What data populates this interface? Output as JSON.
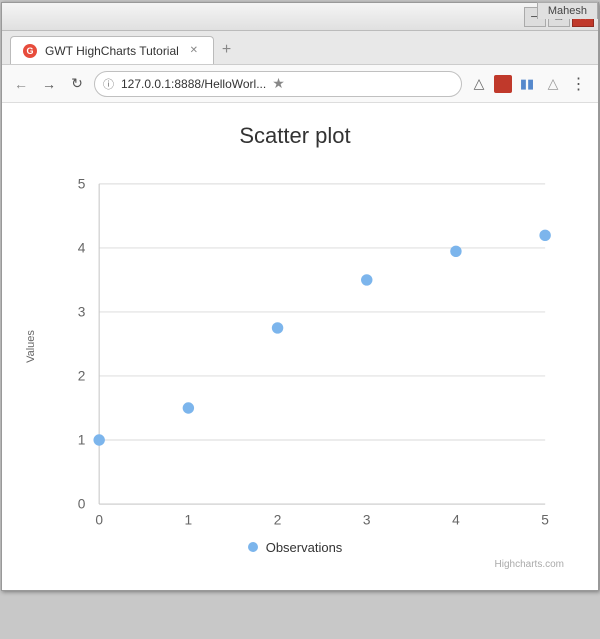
{
  "window": {
    "user_badge": "Mahesh",
    "title": "GWT HighCharts Tutorial",
    "url": "127.0.0.1:8888/HelloWorl...",
    "controls": {
      "minimize": "─",
      "maximize": "□",
      "close": "✕"
    }
  },
  "chart": {
    "title": "Scatter plot",
    "y_axis_label": "Values",
    "x_axis_ticks": [
      "0",
      "1",
      "2",
      "3",
      "4",
      "5"
    ],
    "y_axis_ticks": [
      "0",
      "1",
      "2",
      "3",
      "4",
      "5"
    ],
    "data_points": [
      {
        "x": 0,
        "y": 1.0
      },
      {
        "x": 1,
        "y": 1.5
      },
      {
        "x": 2,
        "y": 2.75
      },
      {
        "x": 3,
        "y": 3.5
      },
      {
        "x": 4,
        "y": 3.95
      },
      {
        "x": 5,
        "y": 4.2
      }
    ],
    "legend_label": "Observations",
    "dot_color": "#7cb5ec",
    "credit": "Highcharts.com"
  }
}
